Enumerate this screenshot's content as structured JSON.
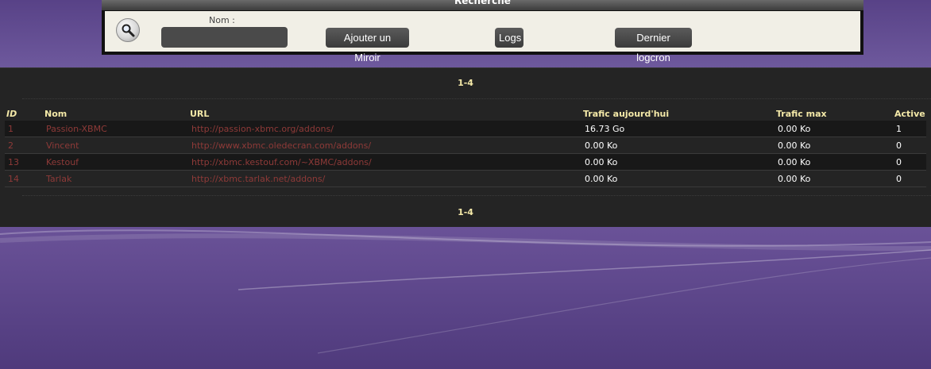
{
  "search": {
    "header_title": "Recherche",
    "nom_label": "Nom :",
    "nom_value": "",
    "buttons": {
      "add_mirror": "Ajouter un Miroir",
      "logs": "Logs",
      "last_logcron": "Dernier logcron"
    },
    "icon": "magnifier-icon"
  },
  "results": {
    "pager_top": "1-4",
    "pager_bottom": "1-4",
    "columns": {
      "id": "ID",
      "nom": "Nom",
      "url": "URL",
      "traffic_today": "Trafic aujourd'hui",
      "traffic_max": "Trafic max",
      "active": "Active"
    },
    "rows": [
      {
        "id": "1",
        "nom": "Passion-XBMC",
        "url": "http://passion-xbmc.org/addons/",
        "traffic_today": "16.73 Go",
        "traffic_max": "0.00 Ko",
        "active": "1"
      },
      {
        "id": "2",
        "nom": "Vincent",
        "url": "http://www.xbmc.oledecran.com/addons/",
        "traffic_today": "0.00 Ko",
        "traffic_max": "0.00 Ko",
        "active": "0"
      },
      {
        "id": "13",
        "nom": "Kestouf",
        "url": "http://xbmc.kestouf.com/~XBMC/addons/",
        "traffic_today": "0.00 Ko",
        "traffic_max": "0.00 Ko",
        "active": "0"
      },
      {
        "id": "14",
        "nom": "Tarlak",
        "url": "http://xbmc.tarlak.net/addons/",
        "traffic_today": "0.00 Ko",
        "traffic_max": "0.00 Ko",
        "active": "0"
      }
    ]
  },
  "colors": {
    "header_text": "#f4e9a8",
    "link": "#8e3a38",
    "panel_bg": "#242424",
    "page_bg": "#6b5399"
  }
}
